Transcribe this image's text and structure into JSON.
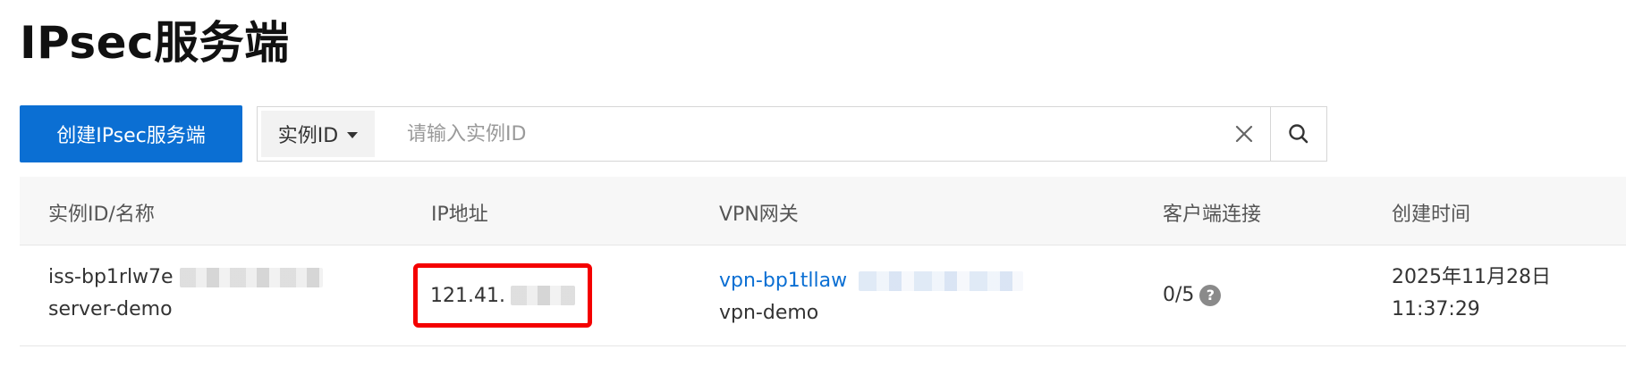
{
  "page": {
    "title": "IPsec服务端"
  },
  "toolbar": {
    "create_label": "创建IPsec服务端",
    "search_select_label": "实例ID",
    "search_placeholder": "请输入实例ID",
    "search_value": ""
  },
  "table": {
    "headers": [
      "实例ID/名称",
      "IP地址",
      "VPN网关",
      "客户端连接",
      "创建时间"
    ],
    "rows": [
      {
        "instance_id": "iss-bp1rlw7e",
        "name": "server-demo",
        "ip": "121.41.",
        "vpn_gateway_id": "vpn-bp1tllaw",
        "vpn_gateway_name": "vpn-demo",
        "client_connections": "0/5",
        "created_date": "2025年11月28日",
        "created_time": "11:37:29"
      }
    ]
  },
  "colors": {
    "primary": "#0b6fd3",
    "highlight_border": "#f40000"
  },
  "icons": {
    "caret": "chevron-down-icon",
    "clear": "close-icon",
    "search": "search-icon",
    "help": "question-circle-icon"
  }
}
